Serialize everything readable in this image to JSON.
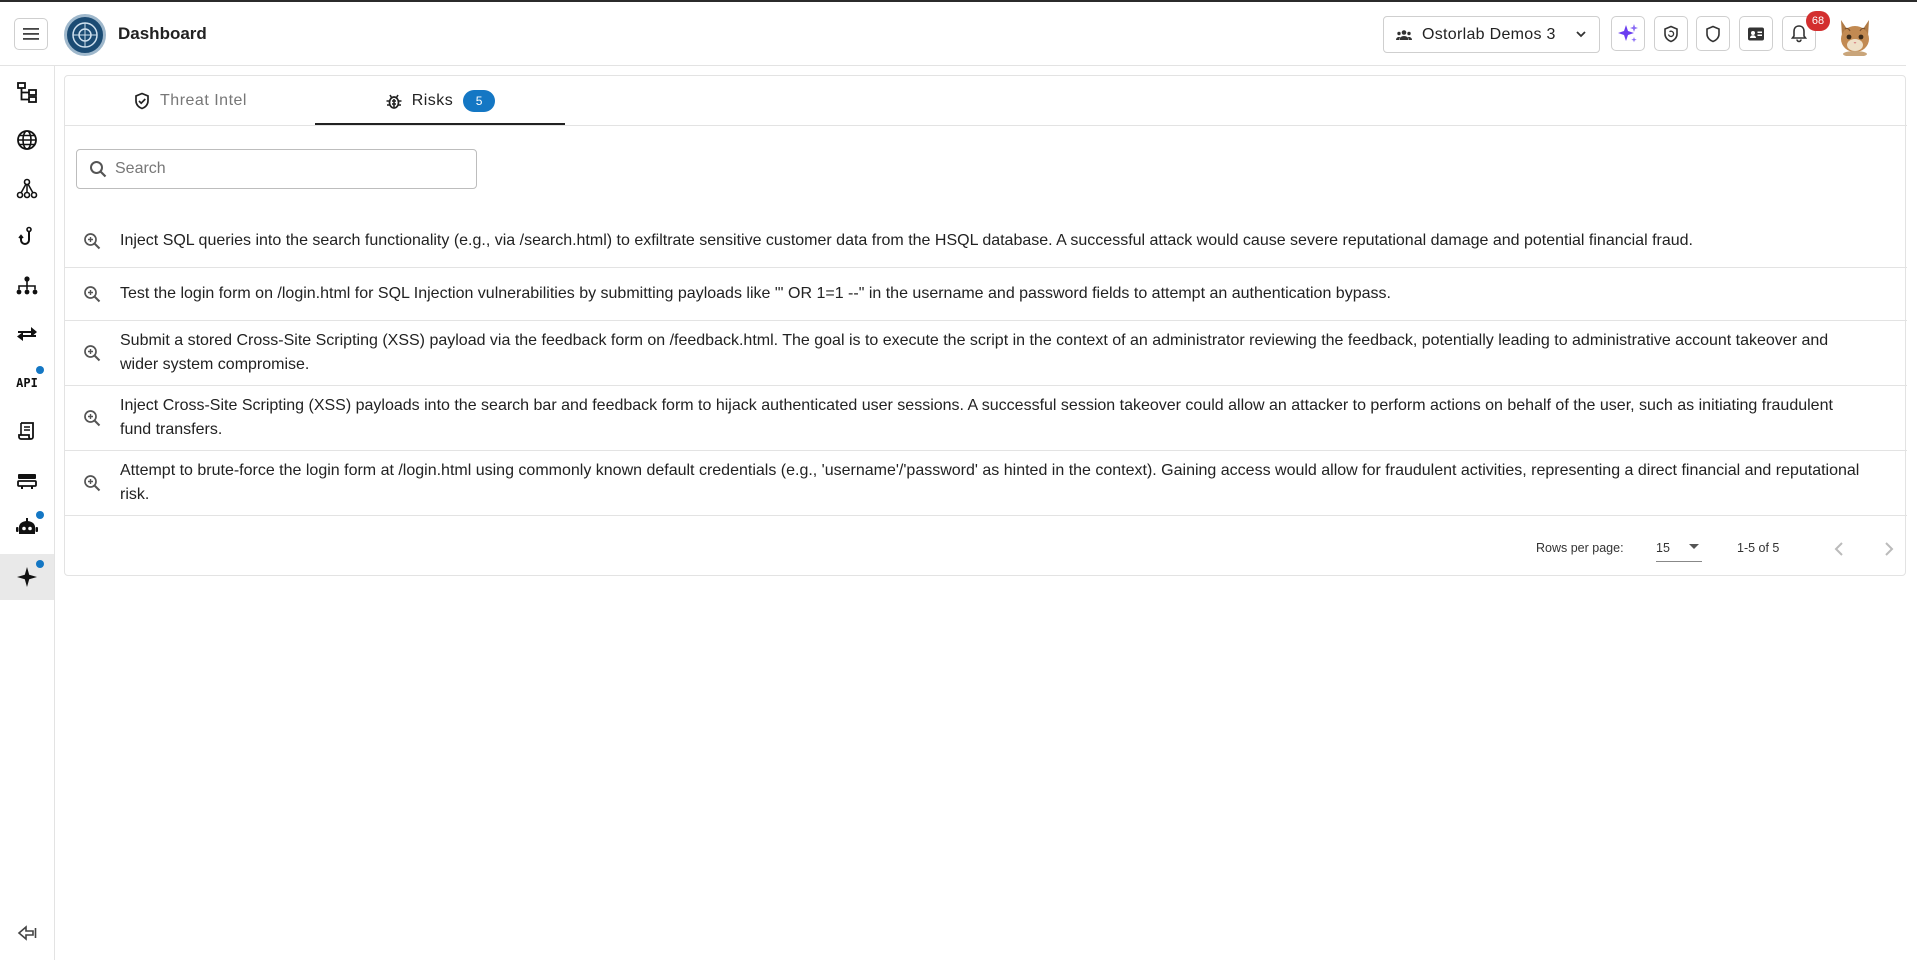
{
  "header": {
    "title": "Dashboard",
    "org_selector": {
      "label": "Ostorlab Demos 3",
      "icon": "group-icon"
    },
    "buttons": [
      {
        "name": "ai-sparkle-button",
        "icon": "sparkle-icon"
      },
      {
        "name": "shield-sync-button",
        "icon": "shield-sync-icon"
      },
      {
        "name": "shield-button",
        "icon": "shield-icon"
      },
      {
        "name": "id-card-button",
        "icon": "id-card-icon"
      },
      {
        "name": "notifications-button",
        "icon": "bell-icon"
      }
    ],
    "notifications_count": "68"
  },
  "sidebar": {
    "items": [
      {
        "icon": "hierarchy-icon",
        "dot": false,
        "active": false
      },
      {
        "icon": "globe-icon",
        "dot": false,
        "active": false
      },
      {
        "icon": "network-icon",
        "dot": false,
        "active": false
      },
      {
        "icon": "hook-icon",
        "dot": false,
        "active": false
      },
      {
        "icon": "org-tree-icon",
        "dot": false,
        "active": false
      },
      {
        "icon": "swap-arrows-icon",
        "dot": false,
        "active": false
      },
      {
        "icon": "api-icon",
        "label": "API",
        "dot": true,
        "active": false
      },
      {
        "icon": "scroll-icon",
        "dot": false,
        "active": false
      },
      {
        "icon": "toolbox-icon",
        "dot": false,
        "active": false
      },
      {
        "icon": "robot-icon",
        "dot": true,
        "active": false
      },
      {
        "icon": "sparkle-icon",
        "dot": true,
        "active": true
      }
    ],
    "collapse_icon": "collapse-arrow-icon"
  },
  "tabs": [
    {
      "label": "Threat Intel",
      "icon": "shield-check-icon",
      "active": false
    },
    {
      "label": "Risks",
      "icon": "bug-icon",
      "active": true,
      "badge": "5"
    }
  ],
  "search": {
    "placeholder": "Search",
    "value": ""
  },
  "risks": [
    {
      "icon": "zoom-in-icon",
      "text": "Inject SQL queries into the search functionality (e.g., via /search.html) to exfiltrate sensitive customer data from the HSQL database. A successful attack would cause severe reputational damage and potential financial fraud."
    },
    {
      "icon": "zoom-in-icon",
      "text": "Test the login form on /login.html for SQL Injection vulnerabilities by submitting payloads like \"' OR 1=1 --\" in the username and password fields to attempt an authentication bypass."
    },
    {
      "icon": "zoom-in-icon",
      "text": "Submit a stored Cross-Site Scripting (XSS) payload via the feedback form on /feedback.html. The goal is to execute the script in the context of an administrator reviewing the feedback, potentially leading to administrative account takeover and wider system compromise."
    },
    {
      "icon": "zoom-in-icon",
      "text": "Inject Cross-Site Scripting (XSS) payloads into the search bar and feedback form to hijack authenticated user sessions. A successful session takeover could allow an attacker to perform actions on behalf of the user, such as initiating fraudulent fund transfers."
    },
    {
      "icon": "zoom-in-icon",
      "text": "Attempt to brute-force the login form at /login.html using commonly known default credentials (e.g., 'username'/'password' as hinted in the context). Gaining access would allow for fraudulent activities, representing a direct financial and reputational risk."
    }
  ],
  "pagination": {
    "rows_per_page_label": "Rows per page:",
    "rows_per_page": "15",
    "range": "1-5 of 5"
  },
  "colors": {
    "accent": "#1477c4",
    "badge_red": "#d32f2f",
    "sparkle": "#6a3df0"
  }
}
